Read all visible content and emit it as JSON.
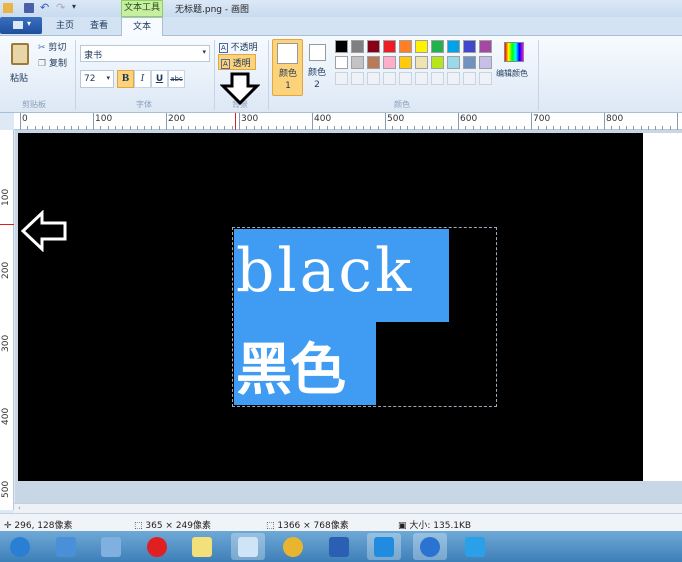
{
  "titlebar": {
    "tools_tab": "文本工具",
    "title": "无标题.png - 画图"
  },
  "tabs": [
    {
      "label": "主页"
    },
    {
      "label": "查看"
    },
    {
      "label": "文本"
    }
  ],
  "clipboard": {
    "paste": "粘贴",
    "cut": "剪切",
    "copy": "复制",
    "group": "剪贴板"
  },
  "font": {
    "family": "隶书",
    "size": "72",
    "bold": "B",
    "italic": "I",
    "underline": "U",
    "strike": "abc",
    "group": "字体"
  },
  "background": {
    "opaque": "不透明",
    "transparent": "透明",
    "group": "背景"
  },
  "colors": {
    "color1": "颜色 1",
    "color2": "颜色 2",
    "edit": "编辑颜色",
    "group": "颜色",
    "row1": [
      "#000000",
      "#7f7f7f",
      "#880015",
      "#ed1c24",
      "#ff7f27",
      "#fff200",
      "#22b14c",
      "#00a2e8",
      "#3f48cc",
      "#a349a4"
    ],
    "row2": [
      "#ffffff",
      "#c3c3c3",
      "#b97a57",
      "#ffaec9",
      "#ffc90e",
      "#efe4b0",
      "#b5e61d",
      "#99d9ea",
      "#7092be",
      "#c8bfe7"
    ]
  },
  "ruler": {
    "h": [
      "0",
      "100",
      "200",
      "300",
      "400",
      "500",
      "600",
      "700",
      "800"
    ],
    "v": [
      "100",
      "200",
      "300",
      "400",
      "500"
    ]
  },
  "canvas": {
    "text_line1": "black",
    "text_line2": "黑色",
    "highlight": "#3f9cf2"
  },
  "status": {
    "cursor": "296, 128像素",
    "selection": "365 × 249像素",
    "size": "1366 × 768像素",
    "file": "大小: 135.1KB"
  },
  "taskbar": [
    "start",
    "desktop",
    "control-panel",
    "xiangqi",
    "sticky-notes",
    "paint",
    "chrome",
    "word",
    "cloud",
    "sogou",
    "ie"
  ]
}
